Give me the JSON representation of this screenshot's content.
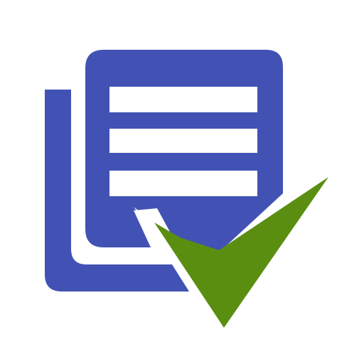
{
  "icon": {
    "name": "document-list-check-icon",
    "colors": {
      "background": "#ffffff",
      "document": "#4252B4",
      "lines": "#ffffff",
      "check": "#5A8E11"
    }
  }
}
